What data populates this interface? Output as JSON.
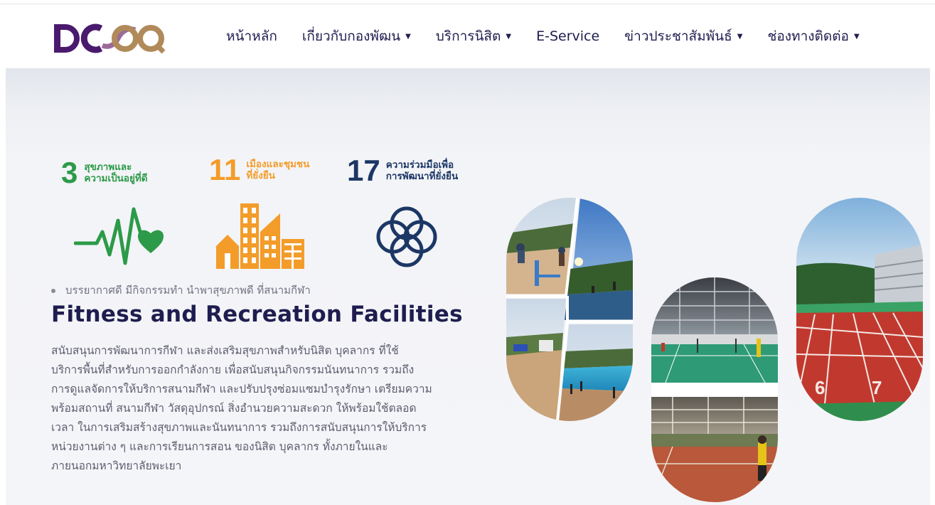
{
  "logo": {
    "text": "DCQQ"
  },
  "nav": {
    "items": [
      {
        "label": "หน้าหลัก",
        "dropdown": false
      },
      {
        "label": "เกี่ยวกับกองพัฒน",
        "dropdown": true
      },
      {
        "label": "บริการนิสิต",
        "dropdown": true
      },
      {
        "label": "E-Service",
        "dropdown": false
      },
      {
        "label": "ข่าวประชาสัมพันธ์",
        "dropdown": true
      },
      {
        "label": "ช่องทางติดต่อ",
        "dropdown": true
      }
    ]
  },
  "sdgs": [
    {
      "number": "3",
      "line1": "สุขภาพและ",
      "line2": "ความเป็นอยู่ที่ดี",
      "color": "#2c9a48",
      "icon": "heartbeat-heart-icon"
    },
    {
      "number": "11",
      "line1": "เมืองและชุมชน",
      "line2": "ที่ยั่งยืน",
      "color": "#f39c2a",
      "icon": "city-buildings-icon"
    },
    {
      "number": "17",
      "line1": "ความร่วมมือเพื่อ",
      "line2": "การพัฒนาที่ยั่งยืน",
      "color": "#1c3765",
      "icon": "partnership-flower-icon"
    }
  ],
  "content": {
    "bullet": "บรรยากาศดี มีกิจกรรมทำ นำพาสุขภาพดี ที่สนามกีฬา",
    "title": "Fitness and Recreation Facilities",
    "description_lines": [
      "สนับสนุนการพัฒนาการกีฬา และส่งเสริมสุขภาพสำหรับนิสิต บุคลากร ที่ใช้",
      "บริการพื้นที่สำหรับการออกกำลังกาย เพื่อสนับสนุนกิจกรรมนันทนาการ รวมถึง",
      "การดูแลจัดการให้บริการสนามกีฬา และปรับปรุงซ่อมแซมบำรุงรักษา เตรียมความ",
      "พร้อมสถานที่ สนามกีฬา วัสดุอุปกรณ์ สิ่งอำนวยความสะดวก ให้พร้อมใช้ตลอด",
      "เวลา ในการเสริมสร้างสุขภาพและนันทนาการ รวมถึงการสนับสนุนการให้บริการ",
      "หน่วยงานต่าง ๆ และการเรียนการสอน ของนิสิต บุคลากร ทั้งภายในและ",
      "ภายนอกมหาวิทยาลัยพะเยา"
    ]
  },
  "photos": {
    "track_lane_numbers": [
      "6",
      "7"
    ]
  },
  "colors": {
    "brand_purple": "#4a1a6e",
    "brand_gold": "#b08a5a",
    "nav_text": "#1f1d4f",
    "title": "#1f1d4f",
    "body_text": "#5e5d70"
  }
}
